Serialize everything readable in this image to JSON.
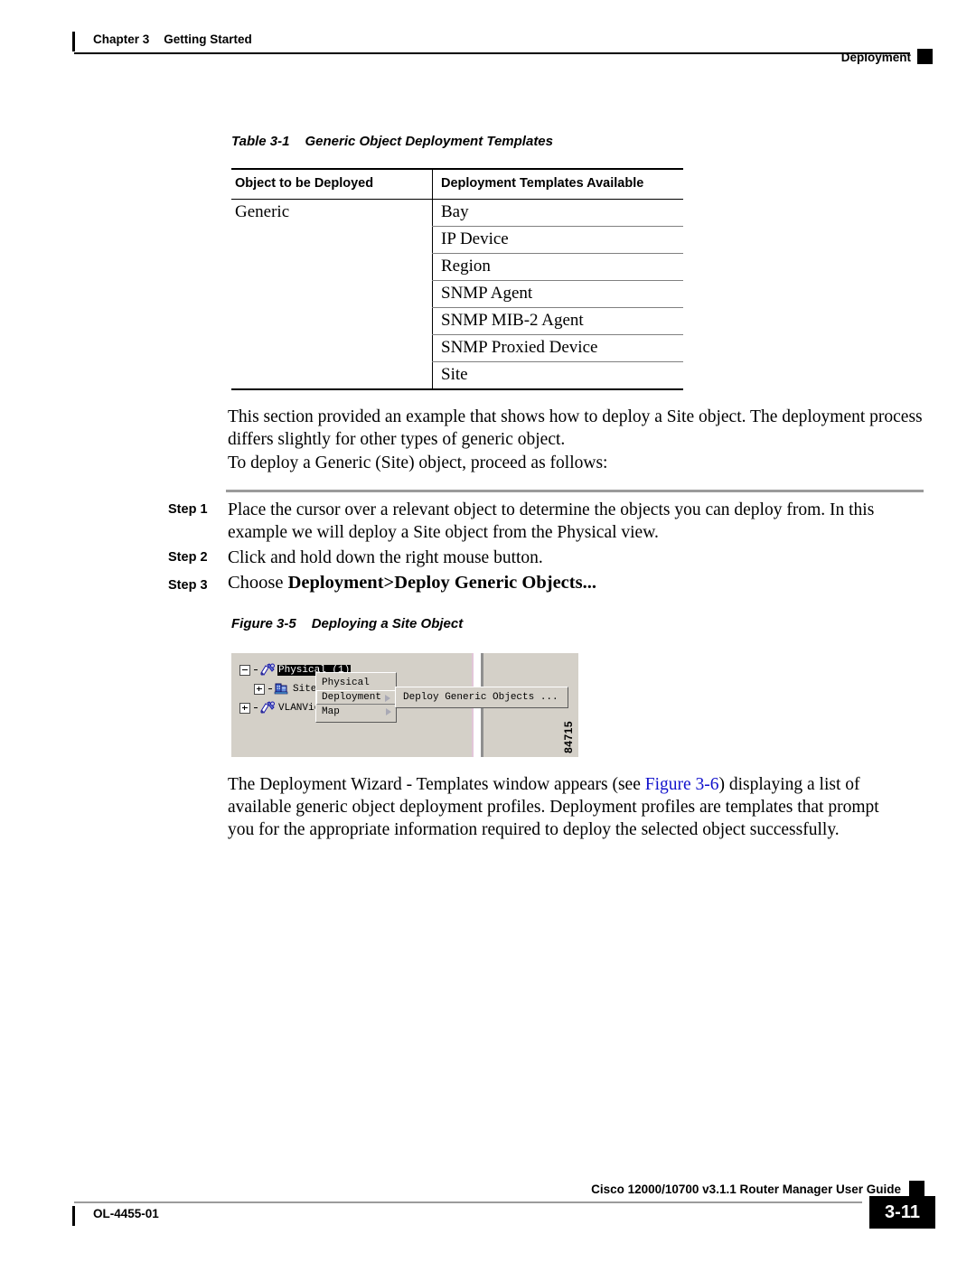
{
  "header": {
    "chapter": "Chapter 3",
    "section": "Getting Started",
    "running_head": "Deployment"
  },
  "table": {
    "caption_number": "Table 3-1",
    "caption_title": "Generic Object Deployment Templates",
    "columns": [
      "Object to be Deployed",
      "Deployment Templates Available"
    ],
    "rows": [
      {
        "object": "Generic",
        "template": "Bay"
      },
      {
        "object": "",
        "template": "IP Device"
      },
      {
        "object": "",
        "template": "Region"
      },
      {
        "object": "",
        "template": "SNMP Agent"
      },
      {
        "object": "",
        "template": "SNMP MIB-2 Agent"
      },
      {
        "object": "",
        "template": "SNMP Proxied Device"
      },
      {
        "object": "",
        "template": "Site"
      }
    ]
  },
  "body": {
    "para1": "This section provided an example that shows how to deploy a Site object. The deployment process differs slightly for other types of generic object.",
    "para2": "To deploy a Generic (Site) object, proceed as follows:",
    "para3_before_link": "The Deployment Wizard - Templates window appears (see ",
    "para3_link": "Figure 3-6",
    "para3_after_link": ") displaying a list of available generic object deployment profiles. Deployment profiles are templates that prompt you for the appropriate information required to deploy the selected object successfully."
  },
  "steps": [
    {
      "label": "Step 1",
      "text": "Place the cursor over a relevant object to determine the objects you can deploy from. In this example we will deploy a Site object from the Physical view."
    },
    {
      "label": "Step 2",
      "text": "Click and hold down the right mouse button."
    },
    {
      "label": "Step 3",
      "text_prefix": "Choose ",
      "text_bold": "Deployment>Deploy Generic Objects...",
      "text_suffix": ""
    }
  ],
  "figure": {
    "caption_number": "Figure 3-5",
    "caption_title": "Deploying a Site Object",
    "art_id": "84715",
    "tree": [
      {
        "label": "Physical (1)",
        "expander": "minus",
        "selected": true,
        "icon": "view-icon"
      },
      {
        "label": "Site-",
        "expander": "plus",
        "selected": false,
        "icon": "site-icon"
      },
      {
        "label": "VLANView",
        "expander": "plus",
        "selected": false,
        "icon": "view-icon"
      }
    ],
    "context_menu": [
      {
        "label": "Physical",
        "has_submenu": false,
        "highlighted": false
      },
      {
        "label": "Deployment",
        "has_submenu": true,
        "highlighted": true
      },
      {
        "label": "Map",
        "has_submenu": true,
        "highlighted": false
      }
    ],
    "submenu": [
      {
        "label": "Deploy Generic Objects ...",
        "highlighted": false
      }
    ]
  },
  "footer": {
    "guide_title": "Cisco 12000/10700 v3.1.1 Router Manager User Guide",
    "doc_id": "OL-4455-01",
    "page_number": "3-11"
  },
  "colors": {
    "link": "#1111cc",
    "rule_gray": "#9b9b9b",
    "app_face": "#d4d0c8"
  }
}
